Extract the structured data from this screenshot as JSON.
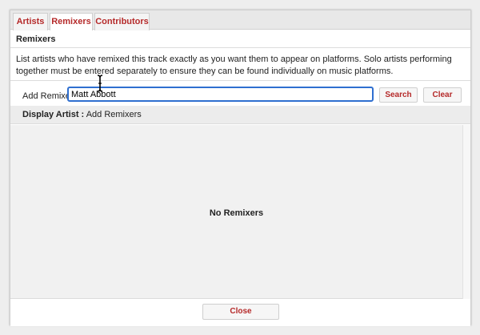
{
  "tabs": [
    {
      "label": "Artists",
      "active": false
    },
    {
      "label": "Remixers",
      "active": true
    },
    {
      "label": "Contributors",
      "active": false
    }
  ],
  "section": {
    "title": "Remixers"
  },
  "description": "List artists who have remixed this track exactly as you want them to appear on platforms. Solo artists performing together must be entered separately to ensure they can be found individually on music platforms.",
  "add_row": {
    "label": "Add Remixer :",
    "input_value": "Matt Abbott",
    "search_label": "Search",
    "clear_label": "Clear"
  },
  "display": {
    "label": "Display Artist :",
    "value": "Add Remixers"
  },
  "list": {
    "empty_text": "No Remixers"
  },
  "footer": {
    "close_label": "Close"
  },
  "colors": {
    "accent": "#b52a2a",
    "focus": "#2f6fd0"
  },
  "icons": {
    "cursor": "text-cursor-icon"
  }
}
